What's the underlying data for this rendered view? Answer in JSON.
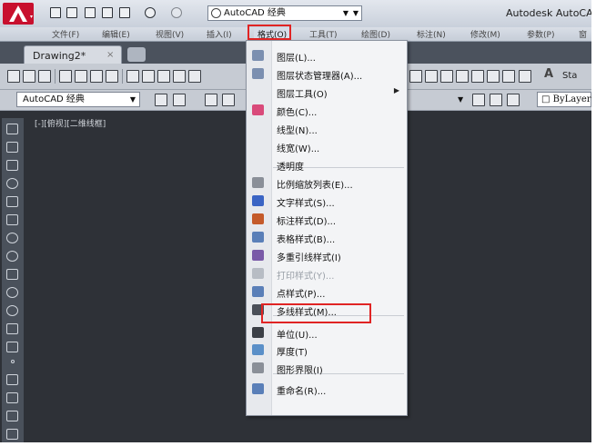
{
  "app": {
    "title": "Autodesk AutoCA",
    "workspace": "AutoCAD 经典"
  },
  "menubar": {
    "items": [
      {
        "key": "file",
        "label": "文件(F)"
      },
      {
        "key": "edit",
        "label": "编辑(E)"
      },
      {
        "key": "view",
        "label": "视图(V)"
      },
      {
        "key": "insert",
        "label": "插入(I)"
      },
      {
        "key": "format",
        "label": "格式(O)"
      },
      {
        "key": "tools",
        "label": "工具(T)"
      },
      {
        "key": "draw",
        "label": "绘图(D)"
      },
      {
        "key": "dimension",
        "label": "标注(N)"
      },
      {
        "key": "modify",
        "label": "修改(M)"
      },
      {
        "key": "parameters",
        "label": "参数(P)"
      },
      {
        "key": "window",
        "label": "窗"
      }
    ]
  },
  "tabs": {
    "active": "Drawing2*",
    "close": "×"
  },
  "toolbar": {
    "style_label": "Sta",
    "workspace_combo": "AutoCAD 经典",
    "layer_value": "ByLayer"
  },
  "viewport": {
    "label": "[-][俯视][二维线框]"
  },
  "format_menu": {
    "items": [
      {
        "label": "图层(L)...",
        "icon": "layers-icon",
        "color": "#7b8fb0"
      },
      {
        "label": "图层状态管理器(A)...",
        "icon": "layer-states-icon",
        "color": "#7b8fb0"
      },
      {
        "label": "图层工具(O)",
        "icon": "",
        "submenu": true
      },
      {
        "label": "颜色(C)...",
        "icon": "color-wheel-icon",
        "color": "#d94a7a"
      },
      {
        "label": "线型(N)...",
        "icon": ""
      },
      {
        "label": "线宽(W)...",
        "icon": ""
      },
      {
        "label": "透明度",
        "icon": ""
      },
      {
        "label": "比例缩放列表(E)...",
        "icon": "scale-list-icon",
        "color": "#8a8f98"
      },
      {
        "label": "文字样式(S)...",
        "icon": "text-style-icon",
        "color": "#3a64c4"
      },
      {
        "label": "标注样式(D)...",
        "icon": "dimension-style-icon",
        "color": "#c45a2a"
      },
      {
        "label": "表格样式(B)...",
        "icon": "table-style-icon",
        "color": "#5a7fb8"
      },
      {
        "label": "多重引线样式(I)",
        "icon": "multileader-style-icon",
        "color": "#7a5aa8"
      },
      {
        "label": "打印样式(Y)...",
        "icon": "plot-style-icon",
        "color": "#b7bcc4",
        "disabled": true
      },
      {
        "label": "点样式(P)...",
        "icon": "point-style-icon",
        "color": "#5a7fb8"
      },
      {
        "label": "多线样式(M)...",
        "icon": "multiline-style-icon",
        "color": "#4a4f58"
      },
      {
        "label": "单位(U)...",
        "icon": "units-icon",
        "color": "#3b3f46"
      },
      {
        "label": "厚度(T)",
        "icon": "thickness-icon",
        "color": "#5a8fc8"
      },
      {
        "label": "图形界限(I)",
        "icon": "drawing-limits-icon",
        "color": "#8a8f98"
      },
      {
        "label": "重命名(R)...",
        "icon": "rename-icon",
        "color": "#5a7fb8"
      }
    ]
  },
  "colors": {
    "highlight": "#e02424",
    "canvas": "#2e3137",
    "menu_bg": "#f3f4f6"
  }
}
